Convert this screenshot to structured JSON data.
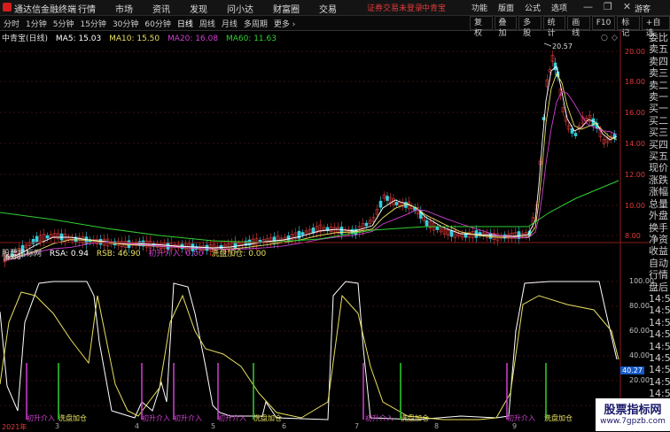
{
  "titlebar": {
    "app_title": "通达信金融终端",
    "menu": [
      "行情",
      "市场",
      "资讯",
      "发现",
      "问小达",
      "财富圈",
      "交易"
    ],
    "notice": "证券交易未登录",
    "stock_name": "中青宝",
    "right_menu": [
      "功能",
      "版面",
      "公式",
      "选项"
    ],
    "window_controls": [
      "—",
      "❐",
      "✕"
    ],
    "user": "游客"
  },
  "toolbar": {
    "periods": [
      "分时",
      "1分钟",
      "5分钟",
      "15分钟",
      "30分钟",
      "60分钟",
      "日线",
      "周线",
      "月线",
      "多周期",
      "更多 ›"
    ],
    "active_period": "日线",
    "tools": [
      "复权",
      "叠加",
      "多股",
      "统计",
      "画线",
      "F10",
      "标记",
      "+自选"
    ]
  },
  "ma_header": {
    "stock": "中青宝(日线)",
    "ma5": "MA5: 15.03",
    "ma10": "MA10: 15.50",
    "ma20": "MA20: 16.08",
    "ma60": "MA60: 11.63"
  },
  "price_axis": [
    "20.00",
    "18.00",
    "16.00",
    "14.00",
    "12.00",
    "10.00",
    "8.00"
  ],
  "price_annotations": {
    "high": "20.57",
    "low": "6.68"
  },
  "indicator_header": {
    "name": "股票指标网",
    "rsa": "RSA: 0.94",
    "rsb": "RSB: 46.90",
    "entry": "初升介入: 0.00",
    "wash": "洗盘加仓: 0.00"
  },
  "indicator_axis": [
    "100.00",
    "80.00",
    "60.00",
    "40.00",
    "20.00"
  ],
  "indicator_current": "40.27",
  "side_column": [
    "委比",
    "卖五",
    "卖四",
    "卖三",
    "卖二",
    "卖一",
    "买一",
    "买二",
    "买三",
    "买四",
    "买五",
    "现价",
    "涨跌",
    "涨幅",
    "总量",
    "外盘",
    "换手",
    "净资",
    "收益",
    "自动",
    "行情",
    "盘后",
    "14:50",
    "14:50",
    "14:50",
    "14:50",
    "14:50",
    "14:50",
    "14:50",
    "14:50",
    "14:50"
  ],
  "signal_labels": [
    {
      "text": "初升介入",
      "color": "#d040d0"
    },
    {
      "text": "洗盘加仓",
      "color": "#e8e060"
    },
    {
      "text": "初升介入",
      "color": "#d040d0"
    },
    {
      "text": "初升介入",
      "color": "#d040d0"
    },
    {
      "text": "初升介入",
      "color": "#d040d0"
    },
    {
      "text": "洗盘加仓",
      "color": "#e8e060"
    },
    {
      "text": "初升介入",
      "color": "#d040d0"
    },
    {
      "text": "洗盘加仓",
      "color": "#e8e060"
    },
    {
      "text": "初升介入",
      "color": "#d040d0"
    },
    {
      "text": "洗盘加仓",
      "color": "#e8e060"
    }
  ],
  "date_axis": [
    "2021年",
    "3",
    "4",
    "5",
    "6",
    "7",
    "8",
    "9"
  ],
  "watermark": {
    "title": "股票指标网",
    "url": "www.7gpzb.com"
  },
  "colors": {
    "ma5": "#ffffff",
    "ma10": "#e8e060",
    "ma20": "#d040d0",
    "ma60": "#30d030",
    "up": "#e03a3a",
    "down": "#30d0e0",
    "rsa": "#ffffff",
    "rsb": "#e8e060"
  }
}
